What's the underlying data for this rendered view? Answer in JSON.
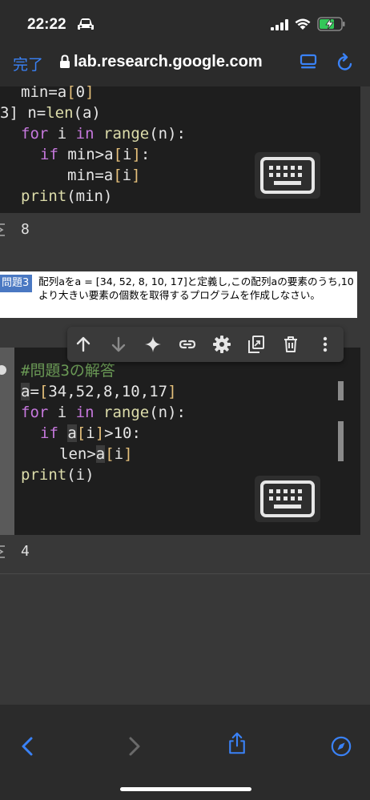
{
  "status_bar": {
    "time": "22:22"
  },
  "browser": {
    "done_label": "完了",
    "url": "lab.research.google.com"
  },
  "cell1": {
    "prefix": "3]",
    "lines": [
      "min=a[0]",
      "n=len(a)",
      "for i in range(n):",
      "if min>a[i]:",
      "min=a[i]",
      "print(min)"
    ],
    "output": "8"
  },
  "text_cell": {
    "label": "問題3",
    "text": "配列aをa = [34, 52, 8, 10, 17]と定義し,この配列aの要素のうち,10より大きい要素の個数を取得するプログラムを作成しなさい。"
  },
  "toolbar": {
    "icons": [
      "arrow-up-icon",
      "arrow-down-icon",
      "sparkle-icon",
      "link-icon",
      "gear-icon",
      "mirror-cell-icon",
      "trash-icon",
      "more-vert-icon"
    ]
  },
  "cell2": {
    "lines": [
      "#問題3の解答",
      "a=[34,52,8,10,17]",
      "for i in range(n):",
      "if a[i]>10:",
      "len>a[i]",
      "print(i)"
    ],
    "output": "4"
  },
  "colors": {
    "accent": "#3a82f7",
    "keyword": "#c678dd",
    "function": "#dcdcaa",
    "bracket": "#e5c07b",
    "comment": "#6a9955",
    "label_bg": "#4a78c2"
  }
}
